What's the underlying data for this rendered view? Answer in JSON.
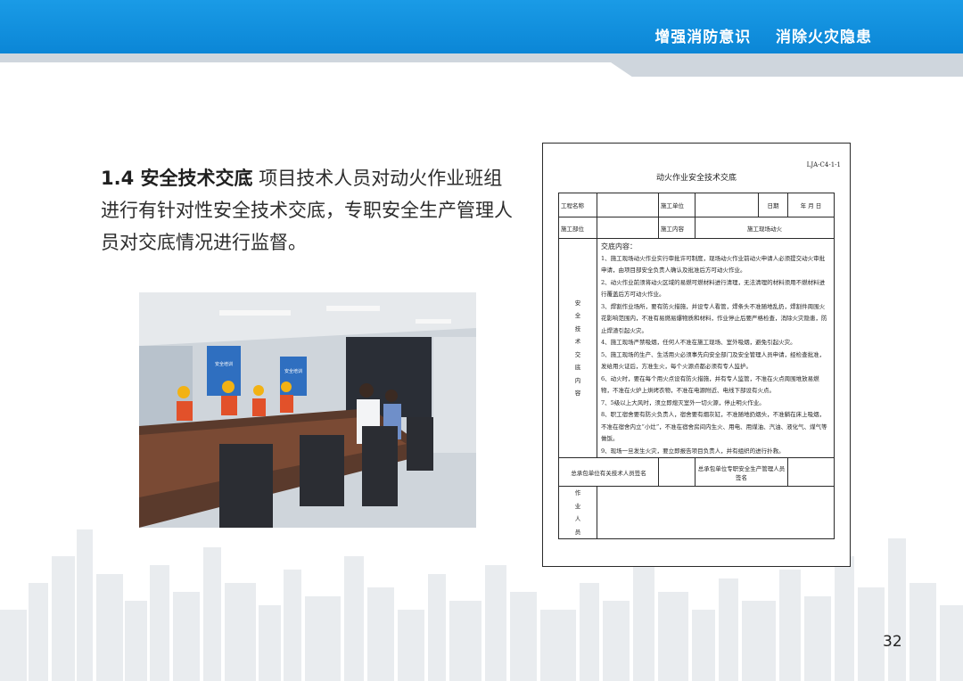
{
  "header": {
    "slogan": "增强消防意识    消除火灾隐患"
  },
  "intro": {
    "heading": "1.4  安全技术交底",
    "body": "项目技术人员对动火作业班组进行有针对性安全技术交底，专职安全生产管理人员对交底情况进行监督。"
  },
  "photo": {
    "banner_left": "安全培训",
    "banner_right": "安全培训"
  },
  "form": {
    "code": "LJA-C4-1-1",
    "title": "动火作业安全技术交底",
    "row1": {
      "project_label": "工程名称",
      "unit_label": "施工单位",
      "date_label": "日期",
      "date_placeholder": "年    月    日"
    },
    "row2": {
      "dept_label": "施工部位",
      "content_label": "施工内容",
      "content_value": "施工现场动火"
    },
    "side_label": [
      "安",
      "全",
      "技",
      "术",
      "交",
      "底",
      "内",
      "容"
    ],
    "content_head": "交底内容：",
    "clauses": [
      "1、施工现场动火作业实行审批许可制度，现场动火作业前动火申请人必须提交动火审批申请，由项目部安全负责人确认及批准后方可动火作业。",
      "2、动火作业前须将动火区域的易燃可燃材料进行清理，无法清理的材料须用不燃材料进行覆盖后方可动火作业。",
      "3、焊割作业场所，要有防火措施，并设专人看管，焊条头不准随地乱扔，焊割件周围火花影响范围内，不准有易燃易爆物质和材料，作业停止后要严格检查，消除火灾隐患，防止焊渣引起火灾。",
      "4、施工现场严禁吸烟，任何人不准在施工现场、室外吸烟，避免引起火灾。",
      "5、施工现场的生产、生活用火必须事先向安全部门及安全管理人员申请，经检查批准，发给用火证后，方准生火，每个火源点都必须有专人监护。",
      "6、动火时，要在每个用火点设有防火措施，并有专人监管，不准在火点周围堆放易燃物，不准在火炉上烘烤衣物，不准在电源附近、电线下部设有火点。",
      "7、5级以上大风时，须立即熄灭室外一切火源，停止明火作业。",
      "8、职工宿舍要有防火负责人，宿舍要有烟灰缸，不准随地扔烟头，不准躺在床上吸烟，不准在宿舍内立“小灶”，不准在宿舍房间内生火、用电、用煤油、汽油、液化气、煤气等做饭。",
      "9、现场一旦发生火灾，要立即报告项目负责人，并有组织的进行扑救。"
    ],
    "sign_left": "总承包单位有关技术人员签名",
    "sign_right": "总承包单位专职安全生产管理人员签名",
    "worker_label": [
      "作",
      "业",
      "人",
      "员"
    ]
  },
  "page_number": "32",
  "colors": {
    "header_blue": "#0b86d6",
    "skyline_gray": "#e8ebee"
  }
}
